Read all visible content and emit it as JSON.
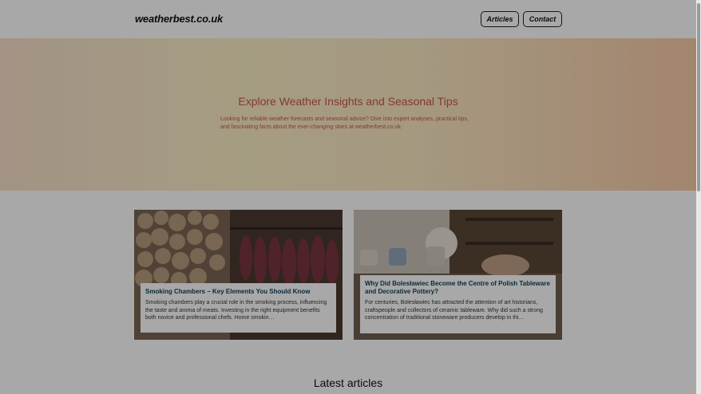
{
  "header": {
    "logo": "weatherbest.co.uk",
    "nav": {
      "articles": "Articles",
      "contact": "Contact"
    }
  },
  "hero": {
    "title": "Explore Weather Insights and Seasonal Tips",
    "text": "Looking for reliable weather forecasts and seasonal advice? Dive into expert analyses, practical tips, and fascinating facts about the ever-changing skies at weatherbest.co.uk."
  },
  "cards": [
    {
      "title": "Smoking Chambers – Key Elements You Should Know",
      "text": "Smoking chambers play a crucial role in the smoking process, influencing the taste and aroma of meats. Investing in the right equipment benefits both novice and professional chefs. Home smokin…"
    },
    {
      "title": "Why Did Bolesławiec Become the Centre of Polish Tableware and Decorative Pottery?",
      "text": "For centuries, Bolesławiec has attracted the attention of art historians, craftspeople and collectors of ceramic tableware. Why did such a strong concentration of traditional stoneware producers develop in thi…"
    }
  ],
  "latest": {
    "heading": "Latest articles"
  }
}
